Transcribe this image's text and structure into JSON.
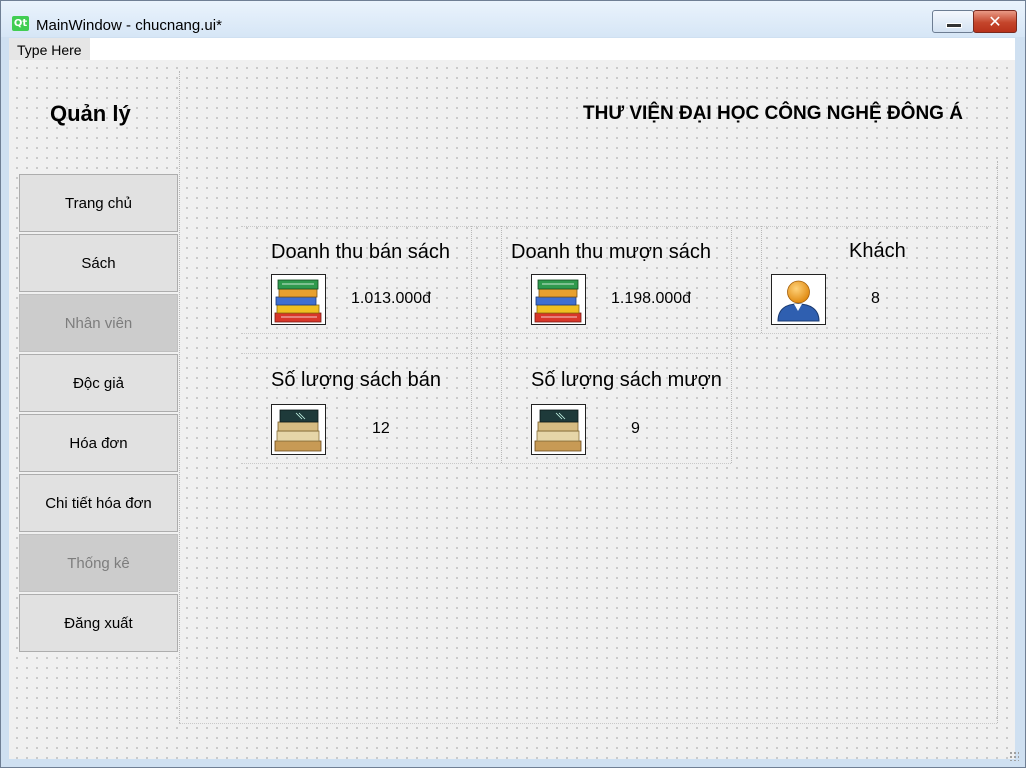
{
  "window": {
    "title": "MainWindow - chucnang.ui*",
    "logo_text": "Qt",
    "close_glyph": "✕"
  },
  "menubar": {
    "item": "Type Here"
  },
  "headings": {
    "left": "Quản lý",
    "right": "THƯ VIỆN ĐẠI HỌC CÔNG NGHỆ ĐÔNG Á"
  },
  "sidebar": {
    "items": [
      {
        "label": "Trang chủ",
        "enabled": true
      },
      {
        "label": "Sách",
        "enabled": true
      },
      {
        "label": "Nhân viên",
        "enabled": false
      },
      {
        "label": "Độc  giả",
        "enabled": true
      },
      {
        "label": "Hóa đơn",
        "enabled": true
      },
      {
        "label": "Chi tiết hóa đơn",
        "enabled": true
      },
      {
        "label": "Thống kê",
        "enabled": false
      },
      {
        "label": "Đăng xuất",
        "enabled": true
      }
    ]
  },
  "stats": {
    "sales_revenue": {
      "title": "Doanh thu bán sách",
      "value": "1.013.000đ",
      "icon": "colorful-books-icon"
    },
    "borrow_revenue": {
      "title": "Doanh thu mượn sách",
      "value": "1.198.000đ",
      "icon": "colorful-books-icon"
    },
    "customers": {
      "title": "Khách",
      "value": "8",
      "icon": "user-icon"
    },
    "books_sold": {
      "title": "Số lượng sách bán",
      "value": "12",
      "icon": "old-books-icon"
    },
    "books_borrowed": {
      "title": "Số lượng sách mượn",
      "value": "9",
      "icon": "old-books-icon"
    }
  },
  "colors": {
    "canvas_bg": "#f0f0f0",
    "button_bg": "#e1e1e1",
    "disabled_bg": "#cccccc",
    "qt_green": "#41cd52",
    "close_red": "#c4452b"
  }
}
